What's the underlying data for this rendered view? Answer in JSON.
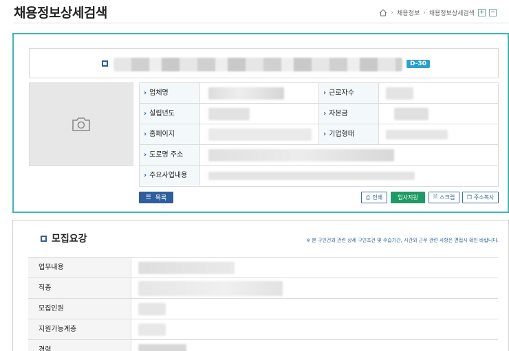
{
  "header": {
    "title": "채용정보상세검색",
    "breadcrumb": [
      "채용정보",
      "채용정보상세검색"
    ],
    "plus": "+",
    "minus": "−"
  },
  "company": {
    "dday": "D-30"
  },
  "info": {
    "labels": {
      "company_name": "업체명",
      "employees": "근로자수",
      "founded": "설립년도",
      "capital": "자본금",
      "homepage": "홈페이지",
      "company_type": "기업형태",
      "road_address": "도로명 주소",
      "business": "주요사업내용"
    }
  },
  "buttons": {
    "list": "목록",
    "print": "인쇄",
    "apply": "입사지원",
    "scrap": "스크랩",
    "copy_address": "주소복사"
  },
  "recruit": {
    "title": "모집요강",
    "notice": "※ 본 구인건과 관련 상세 구인조건 및 수습기간, 시간외 근무 관련 사항은 면접시 확인 바랍니다.",
    "rows": [
      "업무내용",
      "직종",
      "모집인원",
      "지원가능계층",
      "경력"
    ]
  },
  "colors": {
    "teal_border": "#39b7b4",
    "navy": "#2e5e9c",
    "green": "#1e9b64",
    "dday": "#2a9fd0"
  }
}
